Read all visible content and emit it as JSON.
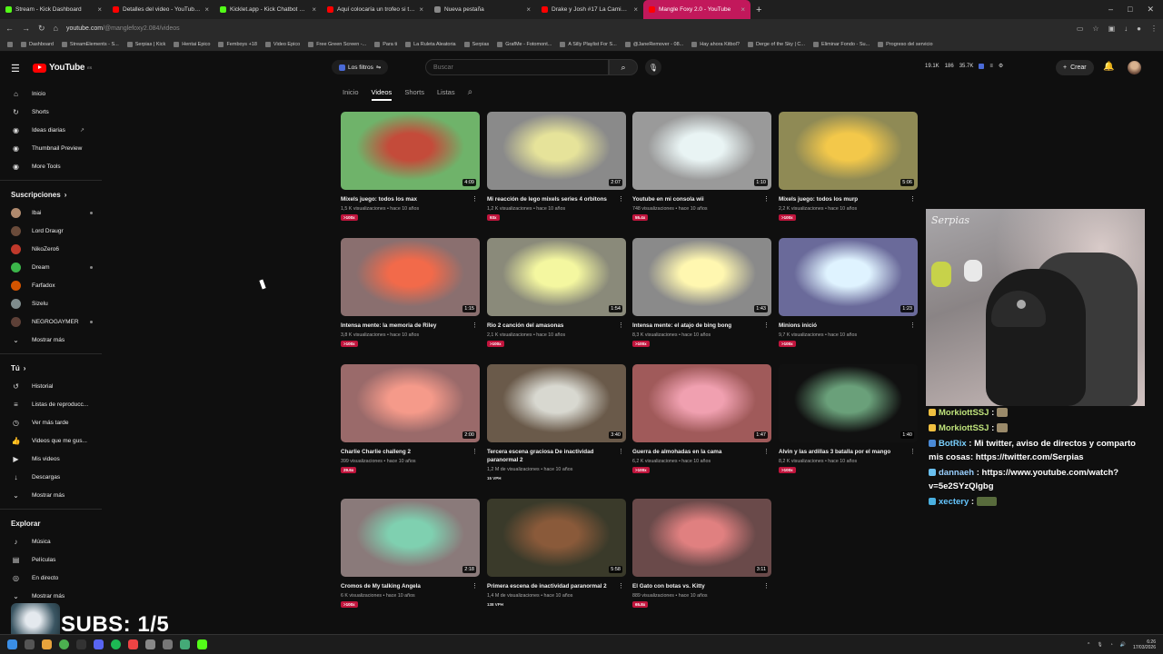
{
  "browser": {
    "tabs": [
      {
        "label": "Stream - Kick Dashboard",
        "color": "#53fc18"
      },
      {
        "label": "Detalles del video - YouTube St",
        "color": "#ff0000"
      },
      {
        "label": "Kicklet.app - Kick Chatbot and",
        "color": "#53fc18"
      },
      {
        "label": "Aquí colocaría un trofeo si tuvie",
        "color": "#ff0000"
      },
      {
        "label": "Nueva pestaña",
        "color": "#888888"
      },
      {
        "label": "Drake y Josh #17 La Camisa De",
        "color": "#ff0000"
      },
      {
        "label": "Mangle Foxy 2.0 - YouTube",
        "color": "#ff0000"
      }
    ],
    "url_host": "youtube.com",
    "url_path": "/@manglefoxy2.084/videos",
    "bookmarks": [
      "Dashboard",
      "StreamElements - S...",
      "Serpias | Kick",
      "Hentai Epico",
      "Femboys +18",
      "Video Epico",
      "Free Green Screen -...",
      "Para ti",
      "La Ruleta Aleatoria",
      "Serpias",
      "GrafMe - Fotomont...",
      "A Silly Playlist For S...",
      "@JaneRemover - 08...",
      "Hay ahora Kitbol?",
      "Derge of the Sky | C...",
      "Eliminar Fondo - Su...",
      "Progreso del servicio"
    ]
  },
  "header": {
    "logo_text": "YouTube",
    "logo_sup": "ES",
    "filters_label": "Los filtros",
    "search_placeholder": "Buscar",
    "stats": [
      "19.1K",
      "186",
      "35.7K"
    ],
    "create_label": "Crear"
  },
  "sidebar": {
    "main": [
      {
        "label": "Inicio",
        "icon": "home-icon",
        "glyph": "⌂"
      },
      {
        "label": "Shorts",
        "icon": "shorts-icon",
        "glyph": "↻"
      },
      {
        "label": "Ideas diarias",
        "icon": "bulb-icon",
        "glyph": "◉"
      },
      {
        "label": "Thumbnail Preview",
        "icon": "preview-icon",
        "glyph": "◉"
      },
      {
        "label": "More Tools",
        "icon": "tools-icon",
        "glyph": "◉"
      }
    ],
    "subs_title": "Suscripciones",
    "subs": [
      {
        "label": "Ibai",
        "color": "#b08a6e",
        "live": true
      },
      {
        "label": "Lord Draugr",
        "color": "#6a4b3a",
        "live": false
      },
      {
        "label": "NikoZero6",
        "color": "#c0392b",
        "live": false
      },
      {
        "label": "Dream",
        "color": "#3bb54a",
        "live": true
      },
      {
        "label": "Farfadox",
        "color": "#d35400",
        "live": false
      },
      {
        "label": "Sizelu",
        "color": "#7f8c8d",
        "live": false
      },
      {
        "label": "NEGROGAYMER",
        "color": "#5d4037",
        "live": true
      }
    ],
    "subs_more": "Mostrar más",
    "you_title": "Tú",
    "you": [
      {
        "label": "Historial",
        "icon": "history-icon",
        "glyph": "↺"
      },
      {
        "label": "Listas de reproducc...",
        "icon": "playlists-icon",
        "glyph": "≡"
      },
      {
        "label": "Ver más tarde",
        "icon": "watch-later-icon",
        "glyph": "◷"
      },
      {
        "label": "Videos que me gus...",
        "icon": "thumb-up-icon",
        "glyph": "👍"
      },
      {
        "label": "Mis videos",
        "icon": "my-videos-icon",
        "glyph": "▶"
      },
      {
        "label": "Descargas",
        "icon": "download-icon",
        "glyph": "↓"
      }
    ],
    "you_more": "Mostrar más",
    "explore_title": "Explorar",
    "explore": [
      {
        "label": "Música",
        "icon": "music-icon",
        "glyph": "♪"
      },
      {
        "label": "Películas",
        "icon": "movies-icon",
        "glyph": "▤"
      },
      {
        "label": "En directo",
        "icon": "live-icon",
        "glyph": "◎"
      }
    ],
    "explore_more": "Mostrar más"
  },
  "channel_tabs": [
    "Inicio",
    "Videos",
    "Shorts",
    "Listas"
  ],
  "active_tab": "Videos",
  "videos": [
    {
      "title": "Mixels juego: todos los max",
      "views": "1,5 K visualizaciones",
      "age": "hace 10 años",
      "duration": "4:09",
      "badge": ">100x",
      "c1": "#6fb36a",
      "c2": "#c44b3a"
    },
    {
      "title": "Mi reacción de lego mixels series 4 orbitons",
      "views": "1,2 K visualizaciones",
      "age": "hace 10 años",
      "duration": "2:07",
      "badge": "93x",
      "c1": "#8a8a8a",
      "c2": "#e6e39a"
    },
    {
      "title": "Youtube en mi consola wii",
      "views": "748 visualizaciones",
      "age": "hace 10 años",
      "duration": "1:10",
      "badge": "55.4x",
      "c1": "#9a9a9a",
      "c2": "#e9f4f4"
    },
    {
      "title": "Mixels juego: todos los murp",
      "views": "2,2 K visualizaciones",
      "age": "hace 10 años",
      "duration": "5:06",
      "badge": ">100x",
      "c1": "#8f8a55",
      "c2": "#f3c84a"
    },
    {
      "title": "Intensa mente: la memoria de Riley",
      "views": "3,8 K visualizaciones",
      "age": "hace 10 años",
      "duration": "1:15",
      "badge": ">100x",
      "c1": "#8a6f6f",
      "c2": "#f26a4a"
    },
    {
      "title": "Rio 2 canción del amasonas",
      "views": "2,1 K visualizaciones",
      "age": "hace 10 años",
      "duration": "1:54",
      "badge": ">100x",
      "c1": "#8a8a7a",
      "c2": "#f4f7a0"
    },
    {
      "title": "Intensa mente: el atajo de bing bong",
      "views": "8,3 K visualizaciones",
      "age": "hace 10 años",
      "duration": "1:43",
      "badge": ">100x",
      "c1": "#8a8a8a",
      "c2": "#fff7b0"
    },
    {
      "title": "Minions inició",
      "views": "9,7 K visualizaciones",
      "age": "hace 10 años",
      "duration": "1:23",
      "badge": ">100x",
      "c1": "#6a6a9a",
      "c2": "#dff3ff"
    },
    {
      "title": "Charlie Charlie challeng 2",
      "views": "399 visualizaciones",
      "age": "hace 10 años",
      "duration": "2:00",
      "badge": "29.6x",
      "c1": "#9a6a6a",
      "c2": "#f59a8a"
    },
    {
      "title": "Tercera escena graciosa De inactividad paranormal 2",
      "views": "1,2 M de visualizaciones",
      "age": "hace 10 años",
      "duration": "3:40",
      "badge": "15 VPH",
      "c1": "#6a5a4a",
      "c2": "#d8d8d0"
    },
    {
      "title": "Guerra de almohadas en la cama",
      "views": "6,2 K visualizaciones",
      "age": "hace 10 años",
      "duration": "1:47",
      "badge": ">100x",
      "c1": "#a05a5a",
      "c2": "#f0a0b0"
    },
    {
      "title": "Alvin y las ardillas 3 batalla por el mango",
      "views": "8,2 K visualizaciones",
      "age": "hace 10 años",
      "duration": "1:40",
      "badge": ">100x",
      "c1": "#111111",
      "c2": "#6aa07a"
    },
    {
      "title": "Cromos de My talking Angela",
      "views": "6 K visualizaciones",
      "age": "hace 10 años",
      "duration": "2:18",
      "badge": ">100x",
      "c1": "#8a7a7a",
      "c2": "#7fd0b0"
    },
    {
      "title": "Primera escena de inactividad paranormal 2",
      "views": "1,4 M de visualizaciones",
      "age": "hace 10 años",
      "duration": "5:58",
      "badge": "138 VPH",
      "c1": "#3a3a2a",
      "c2": "#8a5a3a"
    },
    {
      "title": "El Gato con botas vs. Kitty",
      "views": "889 visualizaciones",
      "age": "hace 10 años",
      "duration": "3:11",
      "badge": "65.8x",
      "c1": "#6a4a4a",
      "c2": "#e08080"
    }
  ],
  "webcam_sign": "Serpias",
  "chat": [
    {
      "user": "MorkiottSSJ",
      "text": ""
    },
    {
      "user": "MorkiottSSJ",
      "text": ""
    },
    {
      "user": "BotRix",
      "text": "Mi twitter, aviso de directos y comparto mis cosas: https://twitter.com/Serpias"
    },
    {
      "user": "dannaeh",
      "text": "https://www.youtube.com/watch?v=5e2SYzQlgbg"
    },
    {
      "user": "xectery",
      "text": ""
    }
  ],
  "overlay_subs": "SUBS: 1/5",
  "clock_time": "6:26",
  "clock_date": "17/03/2026"
}
